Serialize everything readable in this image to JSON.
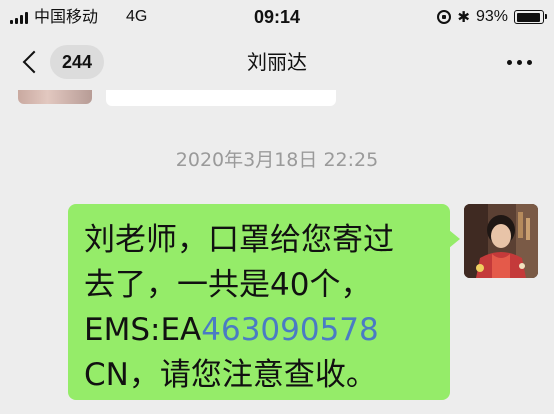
{
  "status_bar": {
    "carrier": "中国移动",
    "network": "4G",
    "time": "09:14",
    "battery_percent_label": "93%",
    "battery_level": 0.93,
    "icons": [
      "signal-icon",
      "orientation-lock-icon",
      "bluetooth-icon",
      "battery-icon"
    ]
  },
  "header": {
    "unread_count": "244",
    "contact_name": "刘丽达",
    "icons": [
      "back-chevron-icon",
      "more-icon"
    ]
  },
  "conversation": {
    "timestamp": "2020年3月18日 22:25",
    "message": {
      "line1": "刘老师，口罩给您寄过",
      "line2": "去了，一共是40个，",
      "line3_prefix": "EMS:EA",
      "tracking_number": "463090578",
      "line4": "CN，请您注意查收。"
    }
  },
  "colors": {
    "background": "#ededed",
    "bubble_green": "#95ec69",
    "link_blue": "#4a7bc4",
    "timestamp_gray": "#9a9a9a"
  }
}
